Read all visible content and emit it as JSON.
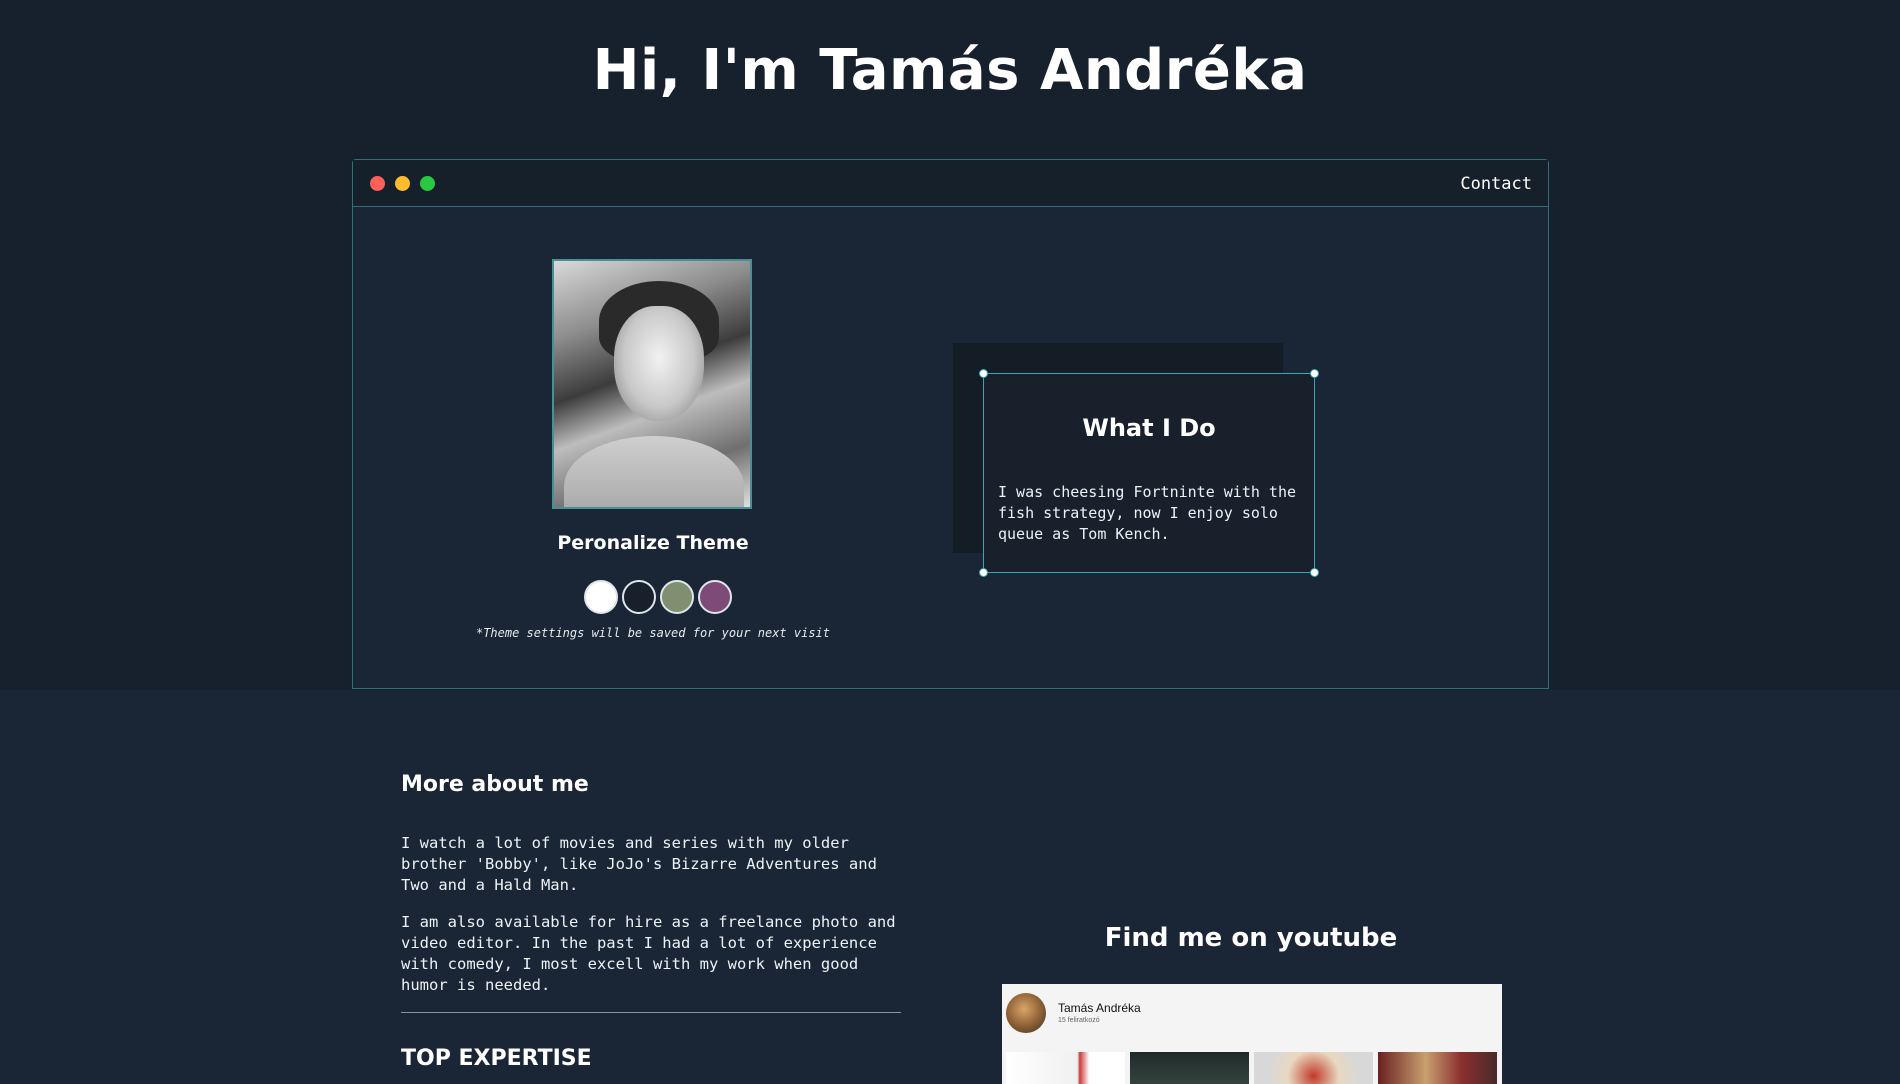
{
  "header": {
    "title": "Hi, I'm Tamás Andréka"
  },
  "window": {
    "contact_label": "Contact",
    "controls": [
      "close",
      "minimize",
      "maximize"
    ]
  },
  "profile": {
    "photo_alt": "",
    "theme_title": "Peronalize Theme",
    "theme_note": "*Theme settings will be saved for your next visit",
    "swatches": [
      {
        "name": "white",
        "color": "#ffffff"
      },
      {
        "name": "dark",
        "color": "#17202b"
      },
      {
        "name": "sage",
        "color": "#7f8f6f"
      },
      {
        "name": "plum",
        "color": "#7e4a78"
      }
    ]
  },
  "what_i_do": {
    "title": "What I Do",
    "text": "I was cheesing Fortninte with the fish strategy, now I enjoy solo queue as Tom Kench."
  },
  "more_about": {
    "title": "More about me",
    "paragraph_1": "I watch a lot of movies and series with my older brother 'Bobby', like JoJo's Bizarre Adventures and Two and a Hald Man.",
    "paragraph_2": "I am also available for hire as a freelance photo and video editor. In the past I had a lot of experience with comedy, I most excell with my work when good humor is needed.",
    "top_expertise": "TOP EXPERTISE"
  },
  "youtube": {
    "title": "Find me on youtube",
    "channel_name": "Tamás Andréka",
    "subscribers": "15 feliratkozó"
  },
  "colors": {
    "background": "#1a2535",
    "band": "#17202d",
    "accent": "#3aa6b3"
  }
}
